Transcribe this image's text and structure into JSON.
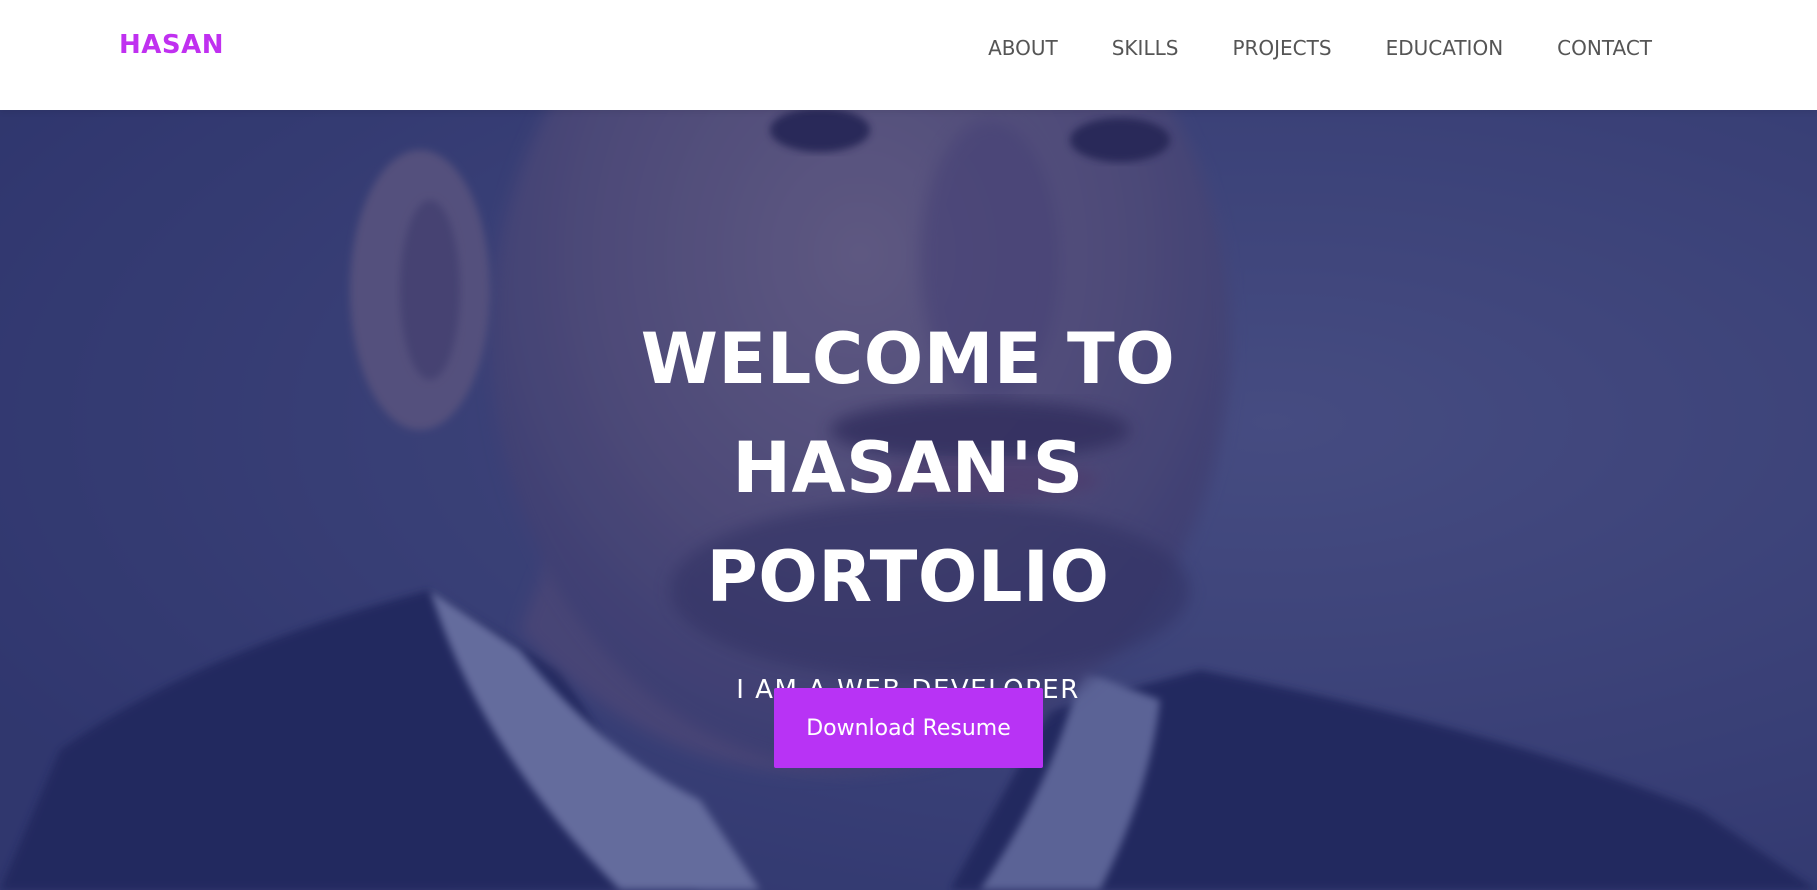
{
  "navbar": {
    "brand": "HASAN",
    "links": [
      "ABOUT",
      "SKILLS",
      "PROJECTS",
      "EDUCATION",
      "CONTACT"
    ]
  },
  "hero": {
    "title_lines": [
      "WELCOME TO",
      "HASAN'S",
      "PORTOLIO"
    ],
    "subtitle": "I AM A WEB DEVELOPER",
    "button_label": "Download Resume"
  },
  "colors": {
    "brand": "#c030f0",
    "accent_button": "#b833f5",
    "overlay": "#28306e",
    "nav_text": "#555555"
  }
}
